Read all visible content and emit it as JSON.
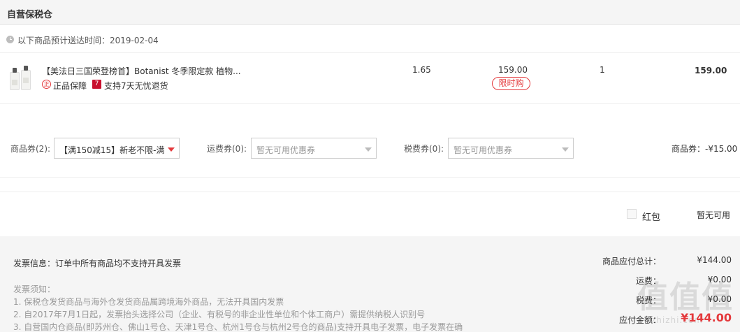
{
  "header": {
    "title": "自营保税仓"
  },
  "delivery": {
    "text": "以下商品预计送达时间：2019-02-04"
  },
  "product": {
    "name": "【美法日三国荣登榜首】Botanist 冬季限定款 植物...",
    "badge_genuine_icon": "正",
    "badge_genuine": "正品保障",
    "badge_return_icon": "7",
    "badge_return": "支持7天无忧退货",
    "weight": "1.65",
    "price": "159.00",
    "limit_tag": "限时购",
    "qty": "1",
    "subtotal": "159.00"
  },
  "coupons": {
    "goods_label": "商品券(2):",
    "goods_value": "【满150减15】新老不限-满...",
    "shipping_label": "运费券(0):",
    "shipping_value": "暂无可用优惠券",
    "tax_label": "税费券(0):",
    "tax_value": "暂无可用优惠券",
    "total": "商品券：-¥15.00"
  },
  "redpacket": {
    "label": "红包",
    "status": "暂无可用"
  },
  "invoice": {
    "info": "发票信息：订单中所有商品均不支持开具发票",
    "notice_title": "发票须知：",
    "notice_lines": [
      "1. 保税仓发货商品与海外仓发货商品属跨境海外商品，无法开具国内发票",
      "2. 自2017年7月1日起，发票抬头选择公司（企业、有税号的非企业性单位和个体工商户）需提供纳税人识别号",
      "3. 自营国内仓商品(即苏州仓、佛山1号仓、天津1号仓、杭州1号仓与杭州2号仓的商品)支持开具电子发票，电子发票在确"
    ]
  },
  "summary": {
    "goods_total_label": "商品应付总计：",
    "goods_total": "¥144.00",
    "shipping_label": "运费：",
    "shipping": "¥0.00",
    "tax_label": "税费：",
    "tax": "¥0.00",
    "payable_label": "应付金额：",
    "payable": "¥144.00"
  },
  "watermark": {
    "logo": "值值值",
    "site": "zhizhi.com"
  },
  "colors": {
    "accent": "#e4393c",
    "footer_bg": "#f5f5f5",
    "header_bg": "#f5f5f5"
  },
  "icons": [
    "clock-icon",
    "product-thumbnail",
    "genuine-badge-icon",
    "return-7day-icon",
    "dropdown-arrow-icon",
    "checkbox"
  ]
}
